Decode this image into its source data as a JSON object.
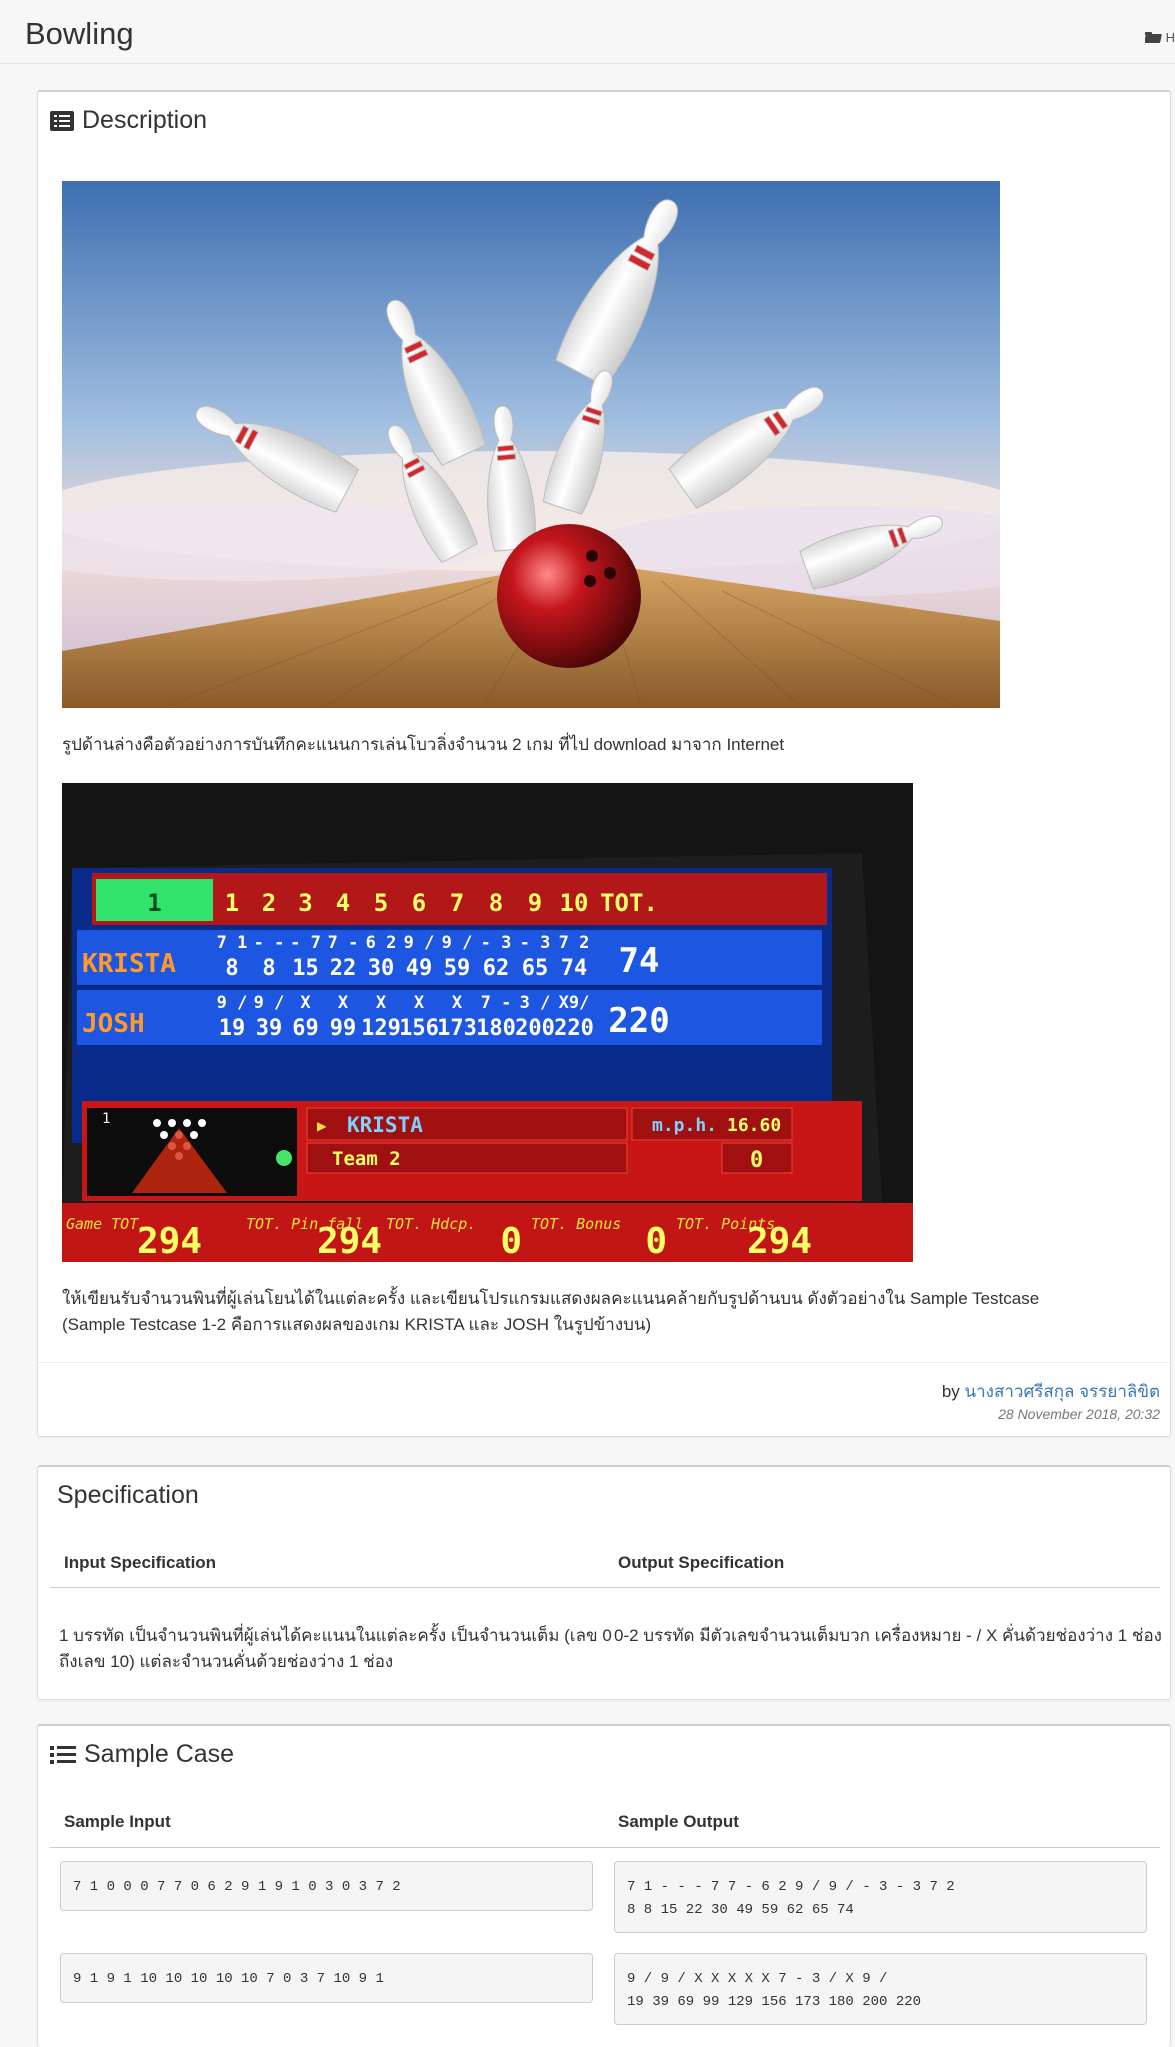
{
  "header": {
    "title": "Bowling",
    "breadcrumb": "H"
  },
  "description": {
    "title": "Description",
    "caption1": "รูปด้านล่างคือตัวอย่างการบันทึกคะแนนการเล่นโบวลิ่งจำนวน 2 เกม ที่ไป download  มาจาก Internet",
    "instruction_line1": "ให้เขียนรับจำนวนพินที่ผู้เล่นโยนได้ในแต่ละครั้ง และเขียนโปรแกรมแสดงผลคะแนนคล้ายกับรูปด้านบน ดังตัวอย่างใน Sample Testcase",
    "instruction_line2": "(Sample Testcase 1-2 คือการแสดงผลของเกม KRISTA และ JOSH ในรูปข้างบน)",
    "by_label": "by",
    "author": "นางสาวศรีสกุล จรรยาลิขิต",
    "date": "28 November 2018, 20:32"
  },
  "scoreboard": {
    "frames": [
      "1",
      "1",
      "2",
      "3",
      "4",
      "5",
      "6",
      "7",
      "8",
      "9",
      "10",
      "TOT."
    ],
    "players": [
      {
        "name": "KRISTA",
        "marks": [
          "7 1",
          "- -",
          "- 7",
          "7 -",
          "6 2",
          "9 /",
          "9 /",
          "- 3",
          "- 3",
          "7 2"
        ],
        "scores": [
          "8",
          "8",
          "15",
          "22",
          "30",
          "49",
          "59",
          "62",
          "65",
          "74"
        ],
        "total": "74"
      },
      {
        "name": "JOSH",
        "marks": [
          "9 /",
          "9 /",
          "X",
          "X",
          "X",
          "X",
          "X",
          "7 -",
          "3 /",
          "X9/"
        ],
        "scores": [
          "19",
          "39",
          "69",
          "99",
          "129",
          "156",
          "173",
          "180",
          "200",
          "220"
        ],
        "total": "220"
      }
    ],
    "current_player": "KRISTA",
    "speed_label": "m.p.h.",
    "speed": "16.60",
    "team": "Team  2",
    "team_value": "0",
    "bottom": [
      {
        "label": "Game TOT.",
        "value": "294"
      },
      {
        "label": "TOT. Pin fall",
        "value": "294"
      },
      {
        "label": "TOT. Hdcp.",
        "value": "0"
      },
      {
        "label": "TOT. Bonus",
        "value": "0"
      },
      {
        "label": "TOT. Points",
        "value": "294"
      }
    ]
  },
  "specification": {
    "title": "Specification",
    "input_header": "Input Specification",
    "output_header": "Output Specification",
    "input_line1": "1 บรรทัด เป็นจำนวนพินที่ผู้เล่นได้คะแนนในแต่ละครั้ง เป็นจำนวนเต็ม (เลข 0",
    "input_line2": "ถึงเลข 10) แต่ละจำนวนคั่นด้วยช่องว่าง 1 ช่อง",
    "output_line1": "0-2 บรรทัด มีตัวเลขจำนวนเต็มบวก เครื่องหมาย - / X คั่นด้วยช่องว่าง 1 ช่อง"
  },
  "sample": {
    "title": "Sample Case",
    "input_header": "Sample Input",
    "output_header": "Sample Output",
    "cases": [
      {
        "input": "7 1 0 0 0 7 7 0 6 2 9 1 9 1 0 3 0 3 7 2",
        "output_line1": "7 1 - - - 7 7 - 6 2 9 / 9 / - 3 - 3 7 2",
        "output_line2": "8 8 15 22 30 49 59 62 65 74"
      },
      {
        "input": "9 1 9 1 10 10 10 10 10 7 0 3 7 10 9 1",
        "output_line1": "9 / 9 / X X X X X 7 - 3 / X 9 /",
        "output_line2": "19 39 69 99 129 156 173 180 200 220"
      }
    ]
  }
}
